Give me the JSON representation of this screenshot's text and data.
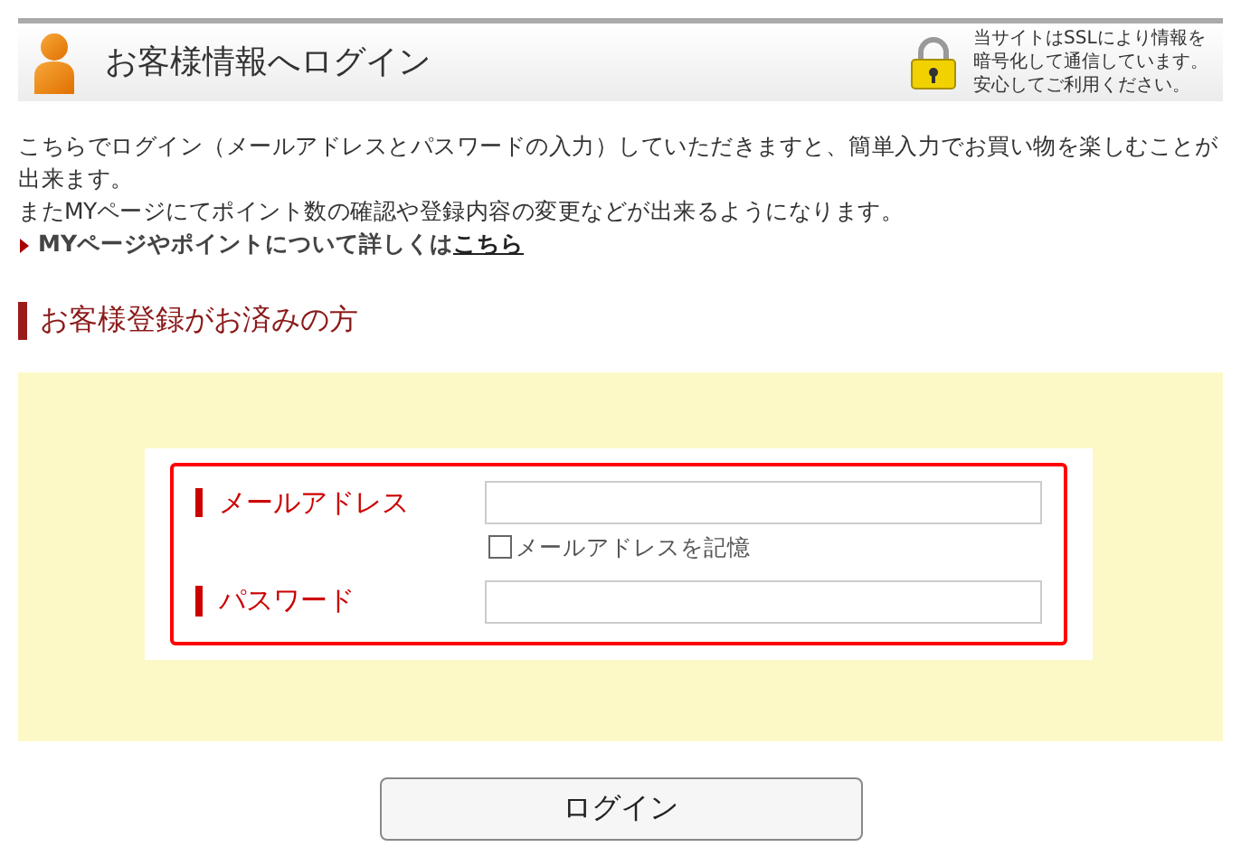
{
  "header": {
    "title": "お客様情報へログイン",
    "ssl_note": [
      "当サイトはSSLにより情報を",
      "暗号化して通信しています。",
      "安心してご利用ください。"
    ]
  },
  "intro": [
    "こちらでログイン（メールアドレスとパスワードの入力）していただきますと、簡単入力でお買い物を楽しむことが出来ます。",
    "またMYページにてポイント数の確認や登録内容の変更などが出来るようになります。"
  ],
  "info_link": {
    "text": "MYページやポイントについて詳しくは",
    "link": "こちら"
  },
  "section_title": "お客様登録がお済みの方",
  "form": {
    "fields": [
      {
        "label": "メールアドレス"
      },
      {
        "label": "パスワード"
      }
    ],
    "remember": {
      "label": "メールアドレスを記憶",
      "checked": false
    }
  },
  "login_button": "ログイン"
}
